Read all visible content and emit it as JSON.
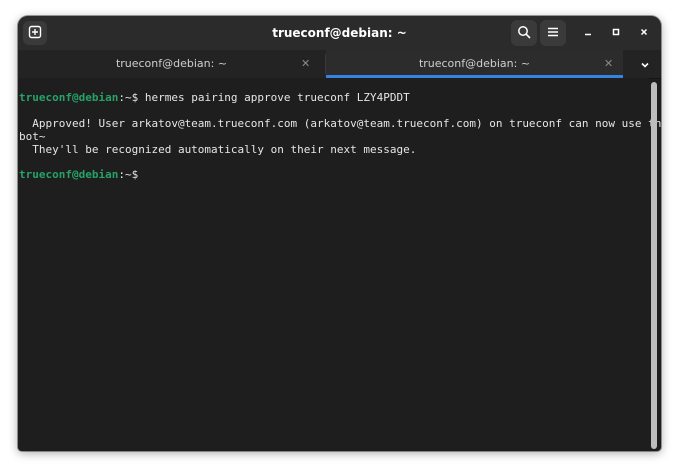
{
  "window": {
    "title": "trueconf@debian: ~"
  },
  "tabs": [
    {
      "label": "trueconf@debian: ~",
      "active": false
    },
    {
      "label": "trueconf@debian: ~",
      "active": true
    }
  ],
  "icons": {
    "new_tab": "new-tab-icon",
    "search": "search-icon",
    "menu": "hamburger-menu-icon",
    "minimize": "minimize-icon",
    "maximize": "maximize-icon",
    "close": "close-icon",
    "tab_close": "close-icon",
    "tabs_menu": "chevron-down-icon"
  },
  "terminal": {
    "prompt_user": "trueconf@debian",
    "prompt_path": ":~$",
    "lines": [
      {
        "kind": "prompt",
        "command": " hermes pairing approve trueconf LZY4PDDT"
      },
      {
        "kind": "output",
        "text": ""
      },
      {
        "kind": "output",
        "text": "  Approved! User arkatov@team.trueconf.com (arkatov@team.trueconf.com) on trueconf can now use the"
      },
      {
        "kind": "output",
        "text": "bot~"
      },
      {
        "kind": "output",
        "text": "  They'll be recognized automatically on their next message."
      },
      {
        "kind": "output",
        "text": ""
      },
      {
        "kind": "prompt",
        "command": ""
      }
    ]
  },
  "colors": {
    "accent": "#3584e4",
    "prompt_green": "#26a269",
    "terminal_bg": "#1e1e1e"
  }
}
